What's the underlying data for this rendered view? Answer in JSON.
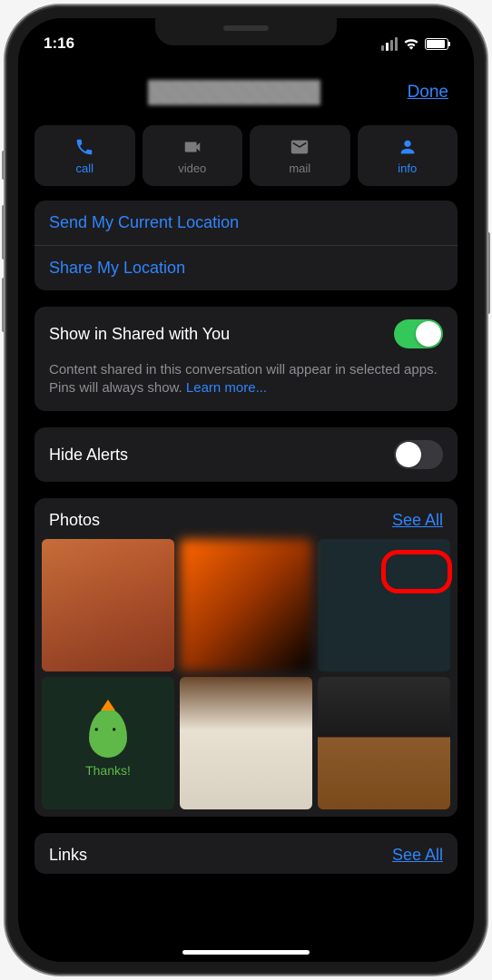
{
  "status": {
    "time": "1:16"
  },
  "header": {
    "done": "Done"
  },
  "actions": {
    "call": {
      "label": "call",
      "icon": "phone-icon"
    },
    "video": {
      "label": "video",
      "icon": "video-icon"
    },
    "mail": {
      "label": "mail",
      "icon": "mail-icon"
    },
    "info": {
      "label": "info",
      "icon": "info-icon"
    }
  },
  "location": {
    "send_current": "Send My Current Location",
    "share": "Share My Location"
  },
  "shared_with_you": {
    "label": "Show in Shared with You",
    "enabled": true,
    "desc_prefix": "Content shared in this conversation will appear in selected apps. Pins will always show. ",
    "learn_more": "Learn more..."
  },
  "hide_alerts": {
    "label": "Hide Alerts",
    "enabled": false
  },
  "photos": {
    "title": "Photos",
    "see_all": "See All",
    "thanks_label": "Thanks!"
  },
  "links": {
    "title": "Links",
    "see_all": "See All"
  },
  "colors": {
    "accent": "#2f85ff",
    "toggle_on": "#34c759"
  }
}
